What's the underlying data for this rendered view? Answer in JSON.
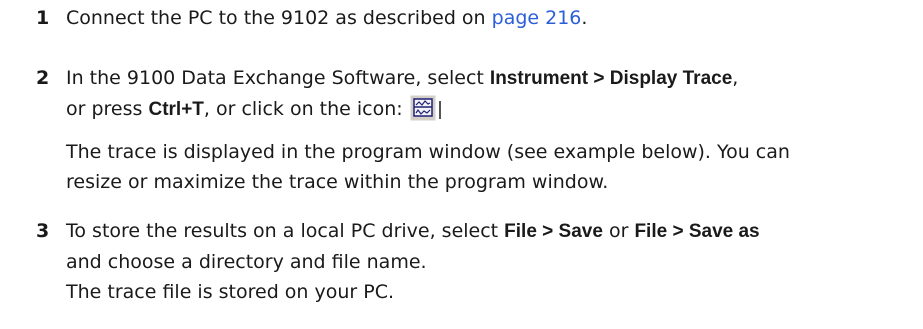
{
  "steps": [
    {
      "number": "1",
      "pre": "Connect the PC to the 9102 as described on ",
      "link": "page 216",
      "post": "."
    },
    {
      "number": "2",
      "l1_pre": "In the 9100 Data Exchange Software, select ",
      "l1_bold": "Instrument > Display Trace",
      "l1_post": ",",
      "l2_pre": "or press ",
      "l2_bold": "Ctrl+T",
      "l2_post": ", or click on the icon:",
      "icon": "display-trace-icon",
      "desc_line1": "The trace is displayed in the program window (see example below). You can",
      "desc_line2": "resize or maximize the trace within the program window."
    },
    {
      "number": "3",
      "l1_pre": "To store the results on a local PC drive, select ",
      "l1_bold1": "File > Save",
      "l1_mid": " or ",
      "l1_bold2": "File > Save as",
      "l2": "and choose a directory and file name.",
      "l3": "The trace file is stored on your PC."
    }
  ],
  "colors": {
    "link": "#2b5fd9",
    "text": "#1a1a1a"
  }
}
